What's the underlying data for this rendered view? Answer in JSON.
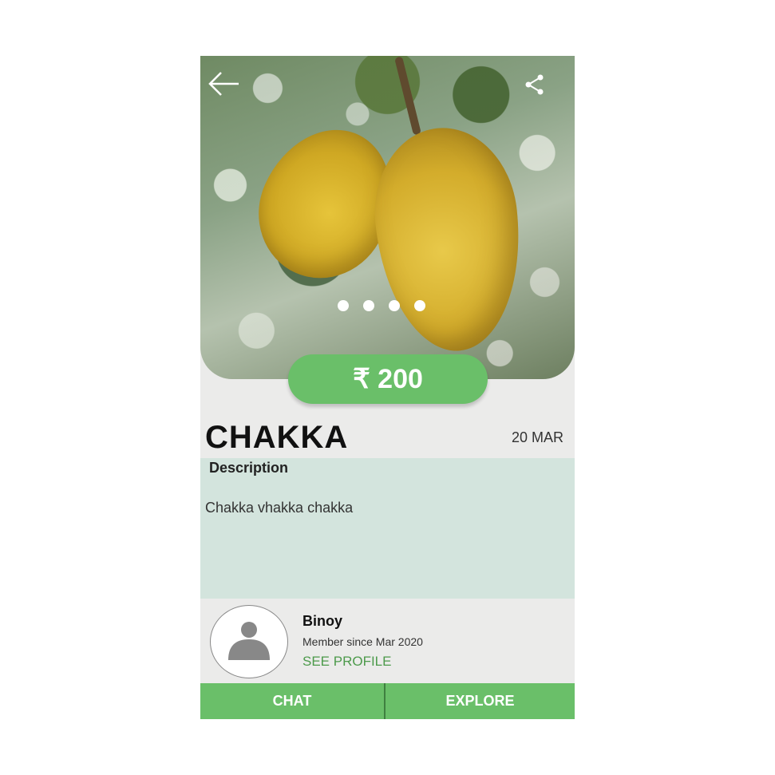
{
  "listing": {
    "price": "₹ 200",
    "title": "CHAKKA",
    "date": "20 MAR",
    "description_label": "Description",
    "description": "Chakka vhakka chakka",
    "image_count": 4
  },
  "seller": {
    "name": "Binoy",
    "member_since": "Member since Mar 2020",
    "see_profile": "SEE PROFILE"
  },
  "actions": {
    "chat": "CHAT",
    "explore": "EXPLORE"
  },
  "icons": {
    "back": "back-arrow-icon",
    "share": "share-icon",
    "avatar": "person-icon"
  },
  "colors": {
    "accent": "#6abf69",
    "description_bg": "#d3e4dd",
    "link": "#4c9a4b"
  }
}
